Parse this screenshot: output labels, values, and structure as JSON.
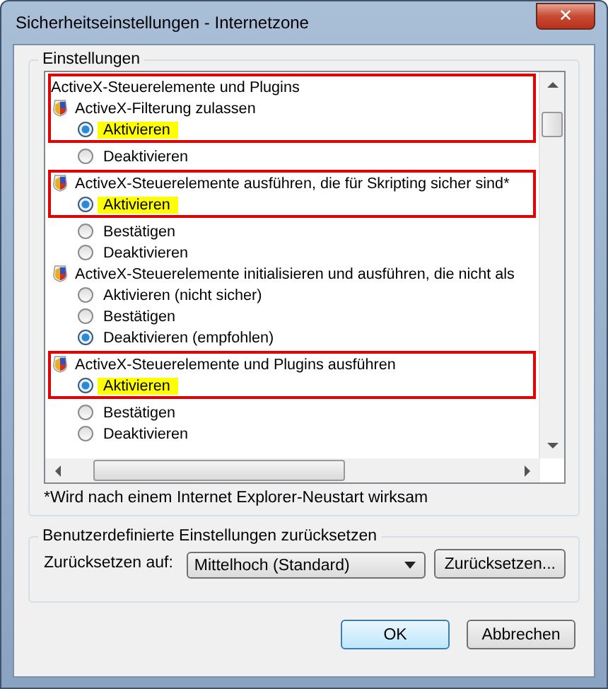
{
  "window": {
    "title": "Sicherheitseinstellungen - Internetzone",
    "close": "✕"
  },
  "settings_group": {
    "title": "Einstellungen",
    "blocks": [
      {
        "framed": true,
        "rows": [
          {
            "kind": "category",
            "text": "ActiveX-Steuerelemente und Plugins"
          },
          {
            "kind": "setting",
            "text": "ActiveX-Filterung zulassen"
          },
          {
            "kind": "option",
            "text": "Aktivieren",
            "selected": true,
            "highlighted": true
          }
        ]
      },
      {
        "framed": false,
        "rows": [
          {
            "kind": "option",
            "text": "Deaktivieren",
            "selected": false,
            "highlighted": false
          }
        ]
      },
      {
        "framed": true,
        "rows": [
          {
            "kind": "setting",
            "text": "ActiveX-Steuerelemente ausführen, die für Skripting sicher sind*"
          },
          {
            "kind": "option",
            "text": "Aktivieren",
            "selected": true,
            "highlighted": true
          }
        ]
      },
      {
        "framed": false,
        "rows": [
          {
            "kind": "option",
            "text": "Bestätigen",
            "selected": false,
            "highlighted": false
          },
          {
            "kind": "option",
            "text": "Deaktivieren",
            "selected": false,
            "highlighted": false
          },
          {
            "kind": "setting",
            "text": "ActiveX-Steuerelemente initialisieren und ausführen, die nicht als"
          },
          {
            "kind": "option",
            "text": "Aktivieren (nicht sicher)",
            "selected": false,
            "highlighted": false
          },
          {
            "kind": "option",
            "text": "Bestätigen",
            "selected": false,
            "highlighted": false
          },
          {
            "kind": "option",
            "text": "Deaktivieren (empfohlen)",
            "selected": true,
            "highlighted": false
          }
        ]
      },
      {
        "framed": true,
        "rows": [
          {
            "kind": "setting",
            "text": "ActiveX-Steuerelemente und Plugins ausführen"
          },
          {
            "kind": "option",
            "text": "Aktivieren",
            "selected": true,
            "highlighted": true
          }
        ]
      },
      {
        "framed": false,
        "rows": [
          {
            "kind": "option",
            "text": "Bestätigen",
            "selected": false,
            "highlighted": false
          },
          {
            "kind": "option",
            "text": "Deaktivieren",
            "selected": false,
            "highlighted": false
          }
        ]
      }
    ],
    "footnote": "*Wird nach einem Internet Explorer-Neustart wirksam"
  },
  "reset_group": {
    "title": "Benutzerdefinierte Einstellungen zurücksetzen",
    "label": "Zurücksetzen auf:",
    "dropdown": "Mittelhoch (Standard)",
    "button": "Zurücksetzen..."
  },
  "buttons": [
    {
      "label": "OK",
      "default": true
    },
    {
      "label": "Abbrechen",
      "default": false
    }
  ]
}
